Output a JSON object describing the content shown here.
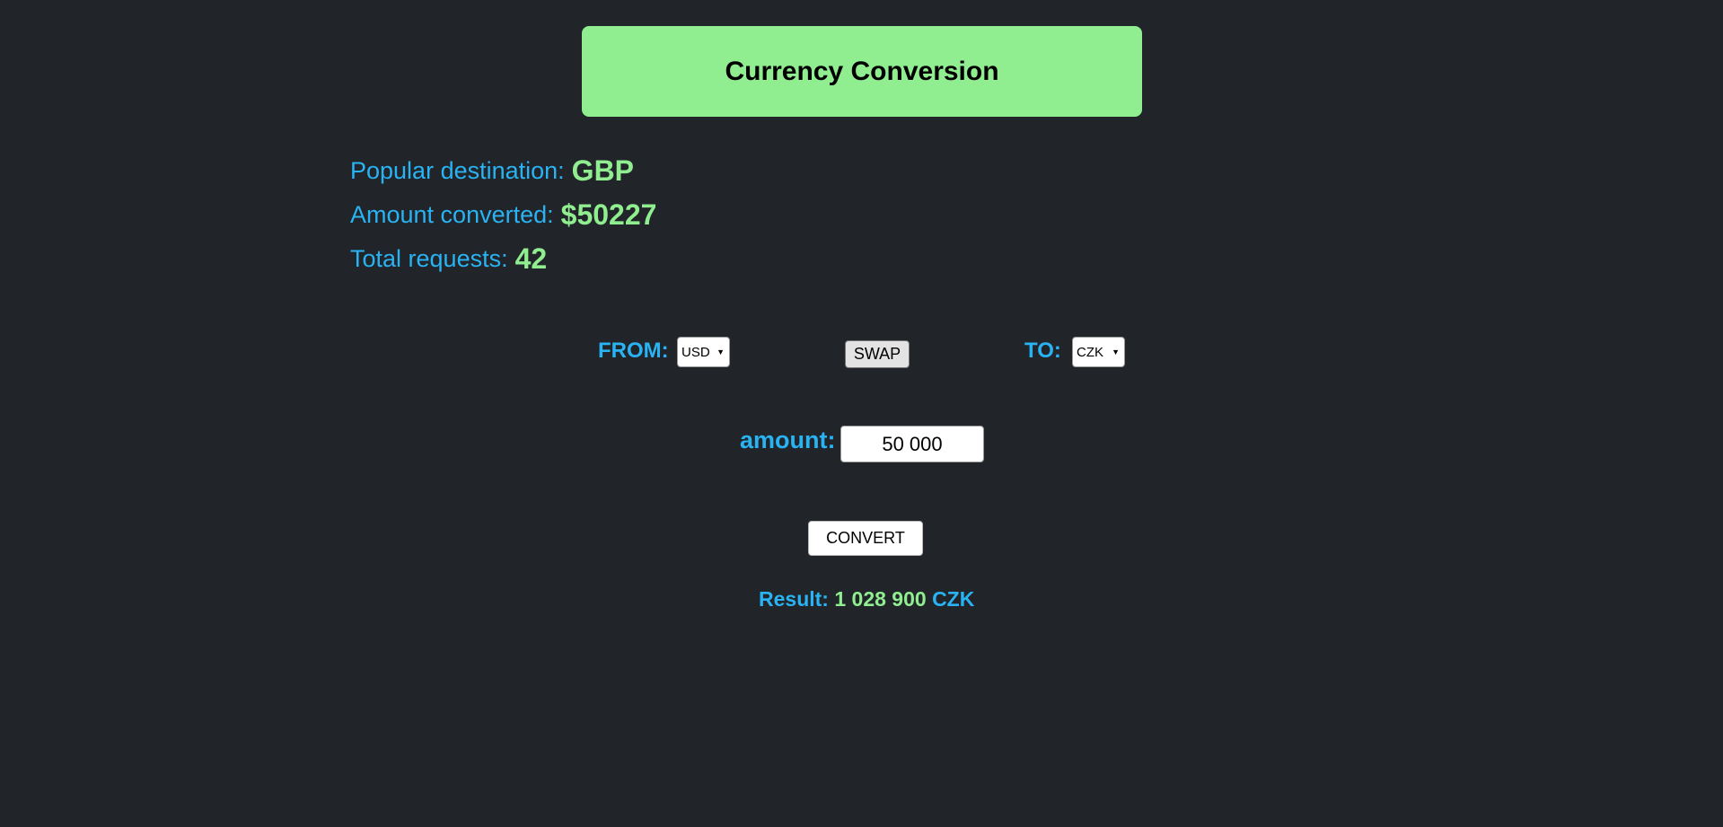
{
  "header": {
    "title": "Currency Conversion"
  },
  "stats": [
    {
      "label": "Popular destination:",
      "value": "GBP"
    },
    {
      "label": "Amount converted:",
      "value": "$50227"
    },
    {
      "label": "Total requests:",
      "value": "42"
    }
  ],
  "converter": {
    "from_label": "FROM:",
    "from_value": "USD",
    "swap_label": "SWAP",
    "to_label": "TO:",
    "to_value": "CZK",
    "amount_label": "amount:",
    "amount_value": "50 000",
    "convert_label": "CONVERT"
  },
  "result": {
    "label": "Result:",
    "value": "1 028 900",
    "currency": "CZK"
  },
  "colors": {
    "background": "#212429",
    "header_bg": "#90ee90",
    "label_blue": "#2ab3f2",
    "value_green": "#90ee90"
  }
}
